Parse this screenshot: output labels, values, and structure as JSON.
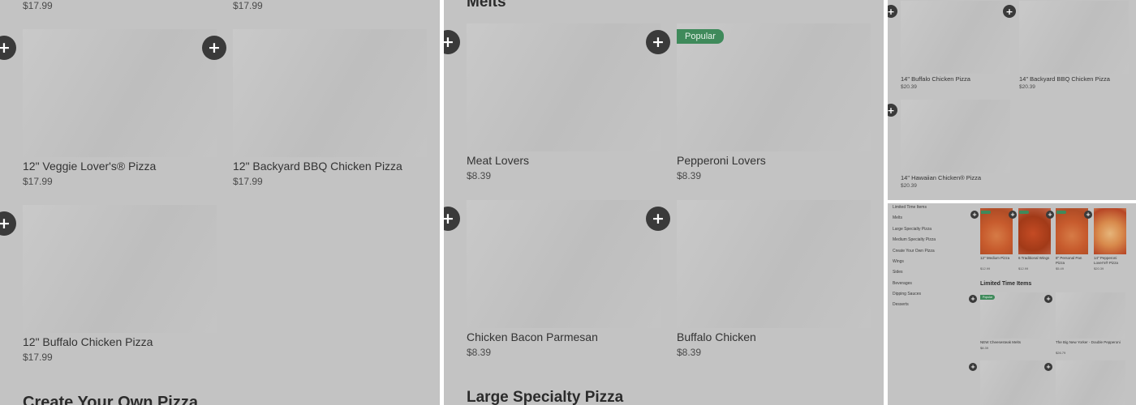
{
  "panel1": {
    "top_prices": [
      "$17.99",
      "$17.99"
    ],
    "cards": [
      {
        "name": "12\" Veggie Lover's® Pizza",
        "price": "$17.99"
      },
      {
        "name": "12\" Backyard BBQ Chicken Pizza",
        "price": "$17.99"
      },
      {
        "name": "12\" Buffalo Chicken Pizza",
        "price": "$17.99"
      }
    ],
    "next_section": "Create Your Own Pizza"
  },
  "panel2": {
    "section_title": "Melts",
    "cards": [
      {
        "name": "Meat Lovers",
        "price": "$8.39",
        "badge": ""
      },
      {
        "name": "Pepperoni Lovers",
        "price": "$8.39",
        "badge": "Popular"
      },
      {
        "name": "Chicken Bacon Parmesan",
        "price": "$8.39",
        "badge": ""
      },
      {
        "name": "Buffalo Chicken",
        "price": "$8.39",
        "badge": ""
      }
    ],
    "next_section": "Large Specialty Pizza"
  },
  "panel3": {
    "cards": [
      {
        "name": "14\" Buffalo Chicken Pizza",
        "price": "$20.39"
      },
      {
        "name": "14\" Backyard BBQ Chicken Pizza",
        "price": "$20.39"
      },
      {
        "name": "14\" Hawaiian Chicken® Pizza",
        "price": "$20.39"
      }
    ]
  },
  "panel4": {
    "sidebar": [
      "Limited Time Items",
      "Melts",
      "Large Specialty Pizza",
      "Medium Specialty Pizza",
      "Create Your Own Pizza",
      "Wings",
      "Sides",
      "Beverages",
      "Dipping Sauces",
      "Desserts"
    ],
    "featured": [
      {
        "name": "12\" Medium Pizza",
        "price": "$12.99"
      },
      {
        "name": "6 Traditional Wings",
        "price": "$12.99"
      },
      {
        "name": "8\" Personal Pan Pizza",
        "price": "$5.49"
      },
      {
        "name": "14\" Pepperoni Lover's® Pizza",
        "price": "$20.39"
      }
    ],
    "section_title": "Limited Time Items",
    "items": [
      {
        "name": "NEW Cheesesteak Melts",
        "price": "$8.39",
        "badge": "Popular"
      },
      {
        "name": "The Big New Yorker - Double Pepperoni",
        "price": "$26.79",
        "badge": ""
      }
    ]
  },
  "icons": {
    "add": "plus-icon"
  },
  "colors": {
    "panel_bg": "#c3c3c3",
    "add_button": "#3a3a3a",
    "badge": "#3f8a5b"
  }
}
